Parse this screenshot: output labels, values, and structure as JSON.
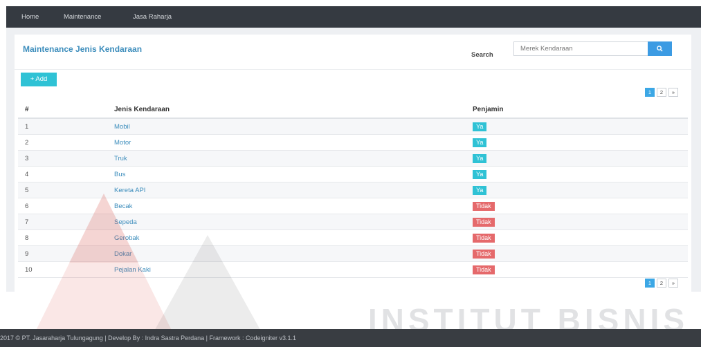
{
  "nav": {
    "items": [
      "Home",
      "Maintenance",
      "Jasa Raharja"
    ]
  },
  "page": {
    "title": "Maintenance Jenis Kendaraan",
    "search_label": "Search",
    "search_placeholder": "Merek Kendaraan",
    "search_icon": "search-icon",
    "add_label": "+ Add"
  },
  "pagination": {
    "pages": [
      "1",
      "2",
      "»"
    ],
    "active": "1"
  },
  "table": {
    "columns": [
      "#",
      "Jenis Kendaraan",
      "Penjamin"
    ],
    "rows": [
      {
        "no": "1",
        "jenis": "Mobil",
        "penjamin": "Ya"
      },
      {
        "no": "2",
        "jenis": "Motor",
        "penjamin": "Ya"
      },
      {
        "no": "3",
        "jenis": "Truk",
        "penjamin": "Ya"
      },
      {
        "no": "4",
        "jenis": "Bus",
        "penjamin": "Ya"
      },
      {
        "no": "5",
        "jenis": "Kereta API",
        "penjamin": "Ya"
      },
      {
        "no": "6",
        "jenis": "Becak",
        "penjamin": "Tidak"
      },
      {
        "no": "7",
        "jenis": "Sepeda",
        "penjamin": "Tidak"
      },
      {
        "no": "8",
        "jenis": "Gerobak",
        "penjamin": "Tidak"
      },
      {
        "no": "9",
        "jenis": "Dokar",
        "penjamin": "Tidak"
      },
      {
        "no": "10",
        "jenis": "Pejalan Kaki",
        "penjamin": "Tidak"
      }
    ]
  },
  "footer": {
    "text": "2017 © PT. Jasaraharja Tulungagung | Develop By : Indra Sastra Perdana | Framework : Codeigniter v3.1.1"
  },
  "watermark": {
    "text": "INSTITUT BISNIS"
  },
  "colors": {
    "accent": "#3c8dbc",
    "badge_yes": "#2fc2d5",
    "badge_no": "#e5696b",
    "topbar": "#353a41"
  }
}
